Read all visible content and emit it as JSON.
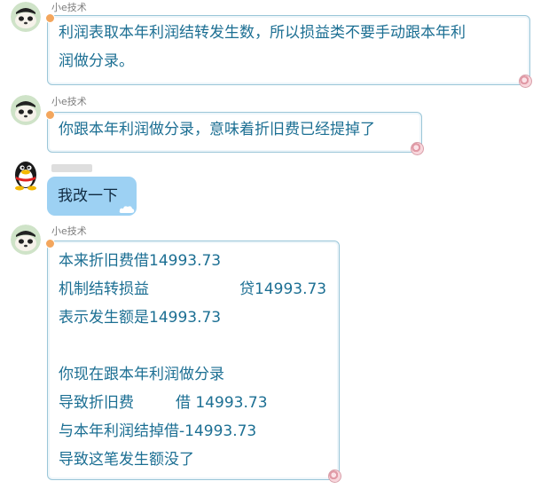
{
  "messages": [
    {
      "sender": "小e技术",
      "lines": [
        "利润表取本年利润结转发生数，所以损益类不要手动跟本年利",
        "润做分录。"
      ]
    },
    {
      "sender": "小e技术",
      "lines": [
        "你跟本年利润做分录，意味着折旧费已经提掉了"
      ]
    },
    {
      "sender": "",
      "lines": [
        "我改一下"
      ]
    },
    {
      "sender": "小e技术",
      "lines": [
        "本来折旧费借14993.73",
        "机制结转损益",
        "表示发生额是14993.73",
        "",
        "你现在跟本年利润做分录",
        "导致折旧费",
        "与本年利润结掉借-14993.73",
        "导致这笔发生额没了"
      ],
      "aligned": {
        "line2_right": "贷14993.73",
        "line6_right": "借 14993.73"
      }
    }
  ],
  "icons": {
    "agent_avatar": "panda-avatar-icon",
    "user_avatar": "penguin-avatar-icon",
    "bubble_corner": "bubble-corner-icon"
  },
  "colors": {
    "agent_text": "#1c6f93",
    "agent_border": "#9ac6d8",
    "user_bubble": "#9dd1f3"
  }
}
